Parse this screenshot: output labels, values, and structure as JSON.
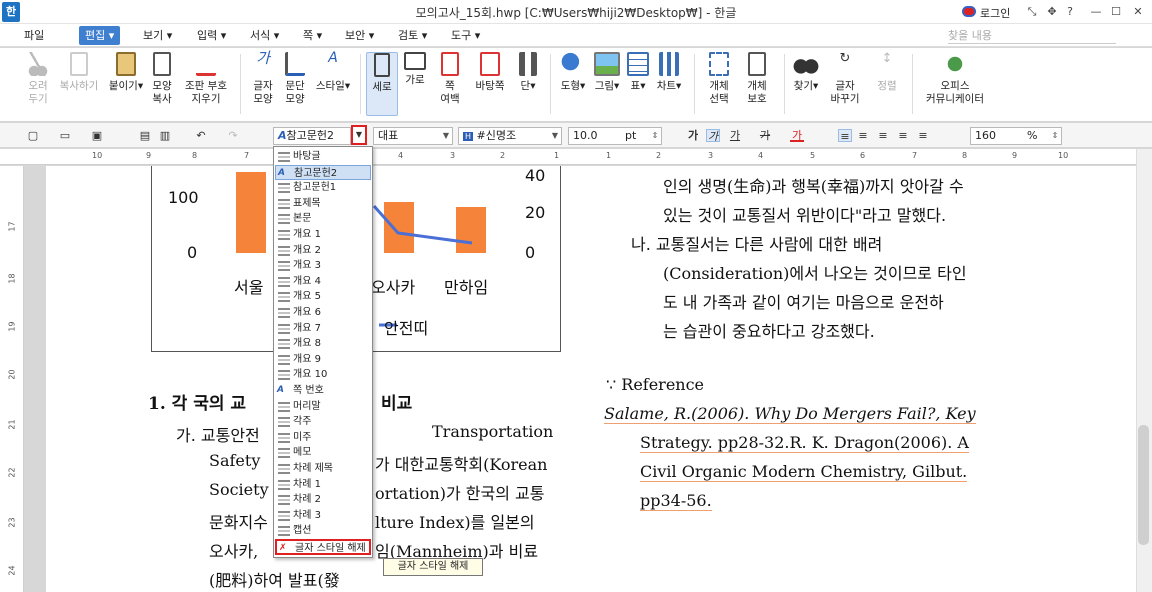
{
  "app": {
    "logo": "한",
    "title": "모의고사_15회.hwp [C:₩Users₩hiji2₩Desktop₩] - 한글",
    "login": "로그인"
  },
  "title_buttons": [
    "⤡",
    "✥",
    "?",
    "—",
    "☐",
    "✕"
  ],
  "menu": {
    "file": "파일",
    "edit": "편집",
    "items": [
      "보기",
      "입력",
      "서식",
      "쪽",
      "보안",
      "검토",
      "도구"
    ],
    "search_placeholder": "찾을 내용"
  },
  "ribbon": [
    {
      "label": "오려\n두기",
      "icon": "scissors-icon",
      "disabled": true
    },
    {
      "label": "복사하기",
      "icon": "copy-icon",
      "disabled": true
    },
    {
      "label": "붙이기",
      "icon": "paste-icon",
      "disabled": false
    },
    {
      "label": "모양\n복사",
      "icon": "format-copy-icon",
      "disabled": false
    },
    {
      "label": "조판 부호\n지우기",
      "icon": "clear-codes-icon",
      "disabled": false
    },
    {
      "label": "글자\n모양",
      "icon": "char-shape-icon",
      "disabled": false
    },
    {
      "label": "문단\n모양",
      "icon": "para-shape-icon",
      "disabled": false
    },
    {
      "label": "스타일",
      "icon": "style-icon",
      "disabled": false
    },
    {
      "label": "세로",
      "icon": "portrait-icon",
      "disabled": false
    },
    {
      "label": "가로",
      "icon": "landscape-icon",
      "disabled": false
    },
    {
      "label": "쪽\n여백",
      "icon": "margin-icon",
      "disabled": false
    },
    {
      "label": "바탕쪽",
      "icon": "master-page-icon",
      "disabled": false
    },
    {
      "label": "단",
      "icon": "columns-icon",
      "disabled": false
    },
    {
      "label": "도형",
      "icon": "shape-icon",
      "disabled": false
    },
    {
      "label": "그림",
      "icon": "picture-icon",
      "disabled": false
    },
    {
      "label": "표",
      "icon": "table-icon",
      "disabled": false
    },
    {
      "label": "차트",
      "icon": "chart-icon",
      "disabled": false
    },
    {
      "label": "개체\n선택",
      "icon": "object-select-icon",
      "disabled": false
    },
    {
      "label": "개체\n보호",
      "icon": "object-protect-icon",
      "disabled": false
    },
    {
      "label": "찾기",
      "icon": "binoculars-icon",
      "disabled": false
    },
    {
      "label": "글자\n바꾸기",
      "icon": "replace-icon",
      "disabled": false
    },
    {
      "label": "정렬",
      "icon": "sort-icon",
      "disabled": true
    },
    {
      "label": "오피스\n커뮤니케이터",
      "icon": "communicator-icon",
      "disabled": false
    }
  ],
  "toolbar2": {
    "style": "참고문헌2",
    "lang": "대표",
    "font": "#신명조",
    "size": "10.0",
    "unit": "pt",
    "zoom": "160",
    "zoom_unit": "%",
    "font_prefix": "H"
  },
  "ruler_h": [
    "10",
    "9",
    "8",
    "7",
    "4",
    "3",
    "2",
    "1",
    "1",
    "2",
    "3",
    "4",
    "5",
    "6",
    "7",
    "8",
    "9",
    "10"
  ],
  "ruler_v": [
    "17",
    "18",
    "19",
    "20",
    "21",
    "22",
    "23",
    "24"
  ],
  "chart": {
    "y_left": [
      "100",
      "0"
    ],
    "y_right": [
      "40",
      "20",
      "0"
    ],
    "categories": [
      "서울",
      "오사카",
      "만하임"
    ],
    "legend": "안전띠"
  },
  "chart_data": {
    "type": "bar",
    "categories": [
      "서울",
      "오사카",
      "만하임"
    ],
    "series": [
      {
        "name": "",
        "values": [
          150,
          95,
          85
        ]
      },
      {
        "name": "안전띠",
        "values": [
          null,
          10,
          5
        ]
      }
    ],
    "ylim": [
      0,
      150
    ]
  },
  "left_text": {
    "heading": "1. 각 국의 교",
    "heading_tail": "비교",
    "lines": [
      {
        "a": "가. 교통안전",
        "b": "Transportation"
      },
      {
        "a": "Safety",
        "b": "가 대한교통학회(Korean"
      },
      {
        "a": "Society",
        "b": "ortation)가 한국의 교통"
      },
      {
        "a": "문화지수",
        "b": "lture Index)를 일본의"
      },
      {
        "a": "오사카,",
        "b": "임(Mannheim)과 비료"
      },
      {
        "a": "(肥料)하여 발표(發",
        "b": ""
      }
    ]
  },
  "right_text": {
    "lines": [
      "인의 생명(生命)과 행복(幸福)까지 앗아갈 수",
      "있는 것이 교통질서 위반이다\"라고 말했다.",
      "나. 교통질서는 다른 사람에 대한 배려",
      "(Consideration)에서 나오는 것이므로 타인",
      "도 내 가족과 같이 여기는 마음으로 운전하",
      "는 습관이 중요하다고 강조했다."
    ],
    "ref_title": "∵ Reference",
    "ref": [
      "Salame, R.(2006). Why Do Mergers Fail?, Key",
      "Strategy. pp28-32.R. K. Dragon(2006). A",
      "Civil Organic Modern Chemistry, Gilbut.",
      "pp34-56."
    ]
  },
  "dropdown": {
    "items": [
      "바탕글",
      "참고문헌2",
      "참고문헌1",
      "표제목",
      "본문",
      "개요 1",
      "개요 2",
      "개요 3",
      "개요 4",
      "개요 5",
      "개요 6",
      "개요 7",
      "개요 8",
      "개요 9",
      "개요 10",
      "쪽 번호",
      "머리말",
      "각주",
      "미주",
      "메모",
      "차례 제목",
      "차례 1",
      "차례 2",
      "차례 3",
      "캡션",
      "글자 스타일 해제"
    ],
    "selected_index": 1
  },
  "tooltip": "글자 스타일 해제",
  "colors": {
    "accent": "#3f7fd0",
    "bar": "#f5843a",
    "line": "#4a6fd6",
    "highlight": "#e02020"
  }
}
